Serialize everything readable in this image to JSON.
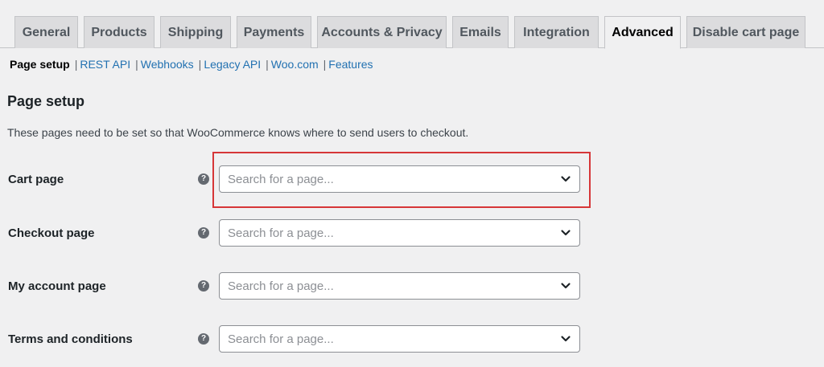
{
  "tabs": [
    {
      "label": "General"
    },
    {
      "label": "Products"
    },
    {
      "label": "Shipping"
    },
    {
      "label": "Payments"
    },
    {
      "label": "Accounts & Privacy"
    },
    {
      "label": "Emails"
    },
    {
      "label": "Integration"
    },
    {
      "label": "Advanced",
      "active": true
    },
    {
      "label": "Disable cart page"
    }
  ],
  "subnav": {
    "current": "Page setup",
    "links": [
      "REST API",
      "Webhooks",
      "Legacy API",
      "Woo.com",
      "Features"
    ],
    "separator": "|"
  },
  "section": {
    "title": "Page setup",
    "description": "These pages need to be set so that WooCommerce knows where to send users to checkout."
  },
  "rows": [
    {
      "label": "Cart page",
      "help": "?",
      "placeholder": "Search for a page...",
      "icon": "chevron-down-icon"
    },
    {
      "label": "Checkout page",
      "help": "?",
      "placeholder": "Search for a page...",
      "icon": "chevron-down-icon"
    },
    {
      "label": "My account page",
      "help": "?",
      "placeholder": "Search for a page...",
      "icon": "chevron-down-icon"
    },
    {
      "label": "Terms and conditions",
      "help": "?",
      "placeholder": "Search for a page...",
      "icon": "chevron-down-icon"
    }
  ],
  "colors": {
    "link": "#2271b1",
    "highlight": "#d63638",
    "background": "#f0f0f1"
  }
}
